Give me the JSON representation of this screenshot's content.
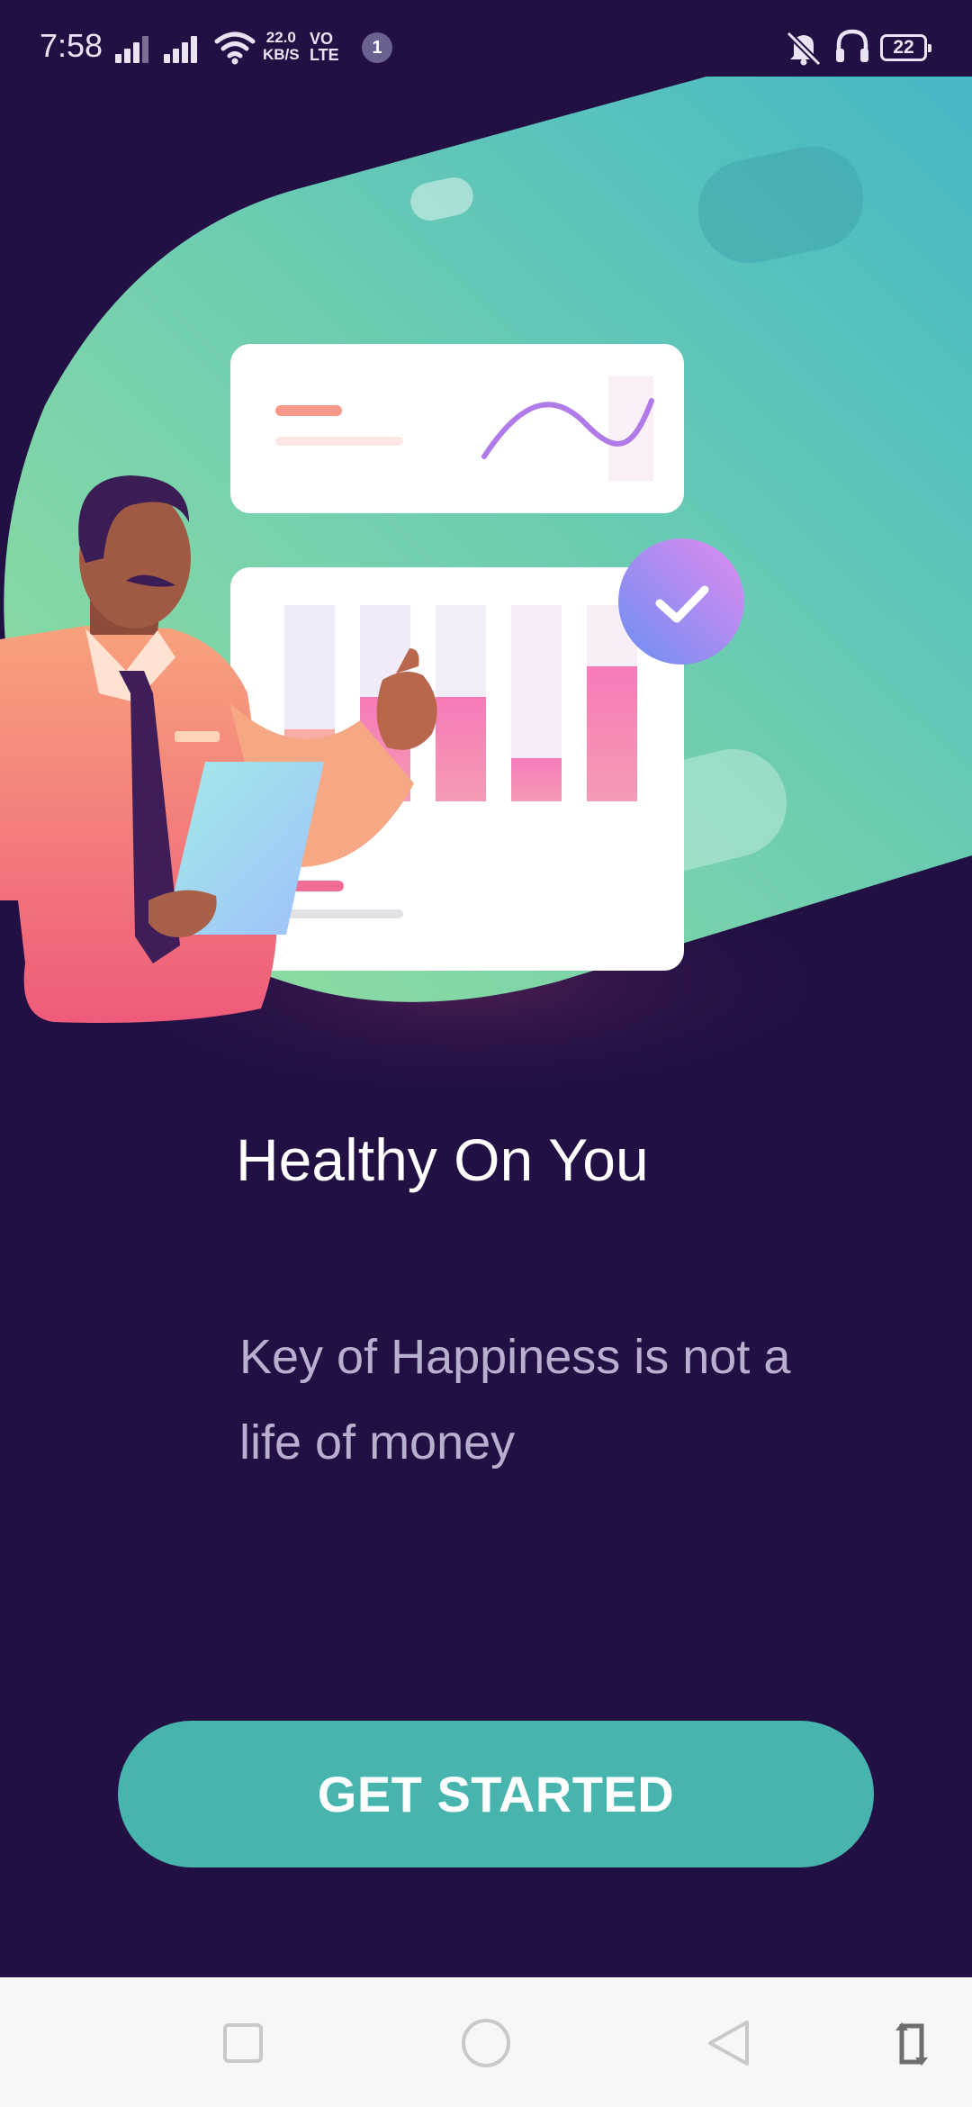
{
  "status_bar": {
    "time": "7:58",
    "net_speed_value": "22.0",
    "net_speed_unit": "KB/S",
    "volte_top": "VO",
    "volte_bottom": "LTE",
    "notification_count": "1",
    "battery_level": "22"
  },
  "onboarding": {
    "headline": "Healthy On You",
    "subtitle": "Key of Happiness is not a life of money",
    "cta_label": "GET STARTED"
  },
  "illustration": {
    "icons": [
      "businessman-illustration",
      "line-chart-card-icon",
      "bar-chart-card-icon",
      "check-badge-icon"
    ]
  },
  "nav_bar": {
    "icons": [
      "recent-apps-icon",
      "home-icon",
      "back-icon",
      "rotate-icon"
    ]
  },
  "colors": {
    "background": "#221045",
    "accent": "#47b5ad",
    "headline": "#ffffff",
    "subtitle": "#b9b0d0"
  }
}
